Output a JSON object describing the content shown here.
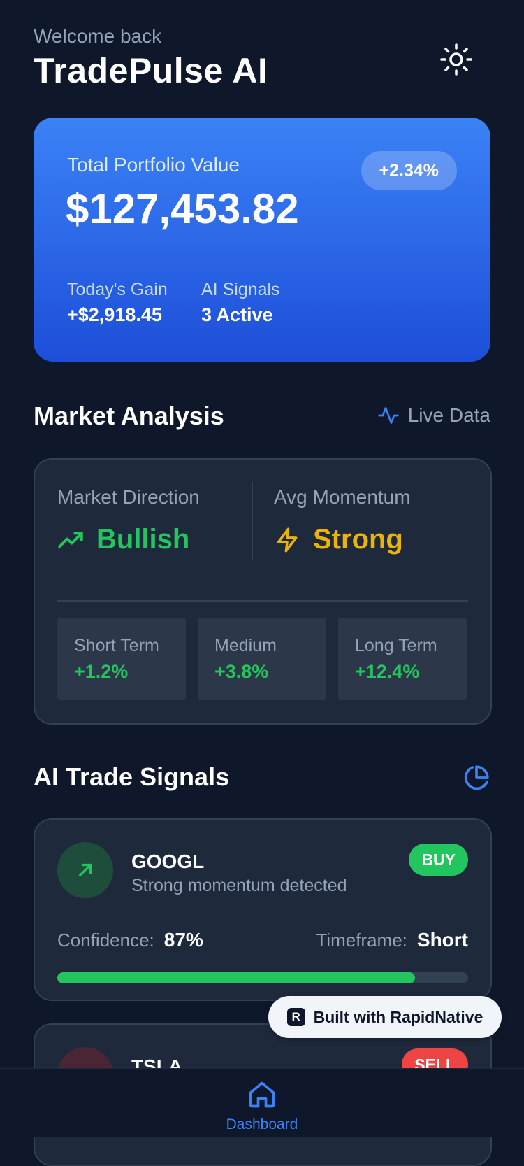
{
  "header": {
    "welcome": "Welcome back",
    "title": "TradePulse AI",
    "theme_icon": "sun-icon"
  },
  "portfolio": {
    "label": "Total Portfolio Value",
    "value": "$127,453.82",
    "change_badge": "+2.34%",
    "todays_gain_label": "Today's Gain",
    "todays_gain_value": "+$2,918.45",
    "ai_signals_label": "AI Signals",
    "ai_signals_value": "3 Active"
  },
  "market_analysis": {
    "title": "Market Analysis",
    "live_label": "Live Data",
    "direction_label": "Market Direction",
    "direction_value": "Bullish",
    "momentum_label": "Avg Momentum",
    "momentum_value": "Strong",
    "terms": [
      {
        "label": "Short Term",
        "value": "+1.2%"
      },
      {
        "label": "Medium",
        "value": "+3.8%"
      },
      {
        "label": "Long Term",
        "value": "+12.4%"
      }
    ]
  },
  "signals": {
    "title": "AI Trade Signals",
    "items": [
      {
        "ticker": "GOOGL",
        "description": "Strong momentum detected",
        "action": "BUY",
        "confidence_label": "Confidence:",
        "confidence_value": "87%",
        "confidence_fraction": 0.87,
        "timeframe_label": "Timeframe:",
        "timeframe_value": "Short"
      },
      {
        "ticker": "TSLA",
        "action": "SELL"
      }
    ]
  },
  "rapidnative_badge": {
    "label": "Built with RapidNative"
  },
  "bottom_nav": {
    "items": [
      {
        "label": "Dashboard",
        "icon": "home-icon"
      }
    ]
  },
  "colors": {
    "background": "#0f172a",
    "card": "#1e293b",
    "accent": "#3b82f6",
    "positive": "#22c55e",
    "warning": "#eab308",
    "negative": "#ef4444"
  }
}
